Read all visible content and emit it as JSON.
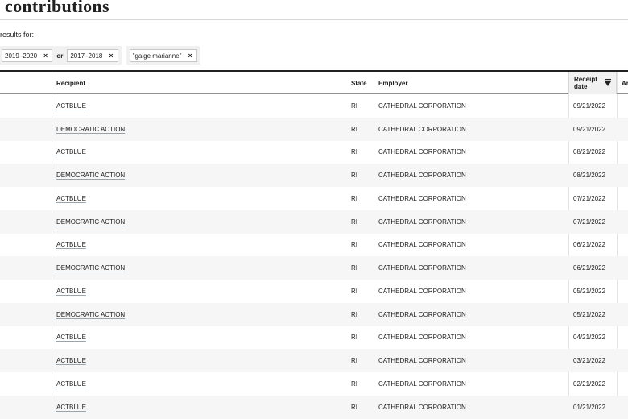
{
  "page": {
    "title": "contributions",
    "results_label": "results for:"
  },
  "filters": {
    "group1": {
      "tag1": "2019–2020",
      "or": "or",
      "tag2": "2017–2018"
    },
    "group2": {
      "tag1": "\"gaige marianne\""
    },
    "remove_glyph": "×"
  },
  "table": {
    "headers": {
      "recipient": "Recipient",
      "state": "State",
      "employer": "Employer",
      "receipt_date": "Receipt date",
      "amount": "Ar"
    },
    "rows": [
      {
        "recipient": "ACTBLUE",
        "state": "RI",
        "employer": "CATHEDRAL CORPORATION",
        "date": "09/21/2022"
      },
      {
        "recipient": "DEMOCRATIC ACTION",
        "state": "RI",
        "employer": "CATHEDRAL CORPORATION",
        "date": "09/21/2022"
      },
      {
        "recipient": "ACTBLUE",
        "state": "RI",
        "employer": "CATHEDRAL CORPORATION",
        "date": "08/21/2022"
      },
      {
        "recipient": "DEMOCRATIC ACTION",
        "state": "RI",
        "employer": "CATHEDRAL CORPORATION",
        "date": "08/21/2022"
      },
      {
        "recipient": "ACTBLUE",
        "state": "RI",
        "employer": "CATHEDRAL CORPORATION",
        "date": "07/21/2022"
      },
      {
        "recipient": "DEMOCRATIC ACTION",
        "state": "RI",
        "employer": "CATHEDRAL CORPORATION",
        "date": "07/21/2022"
      },
      {
        "recipient": "ACTBLUE",
        "state": "RI",
        "employer": "CATHEDRAL CORPORATION",
        "date": "06/21/2022"
      },
      {
        "recipient": "DEMOCRATIC ACTION",
        "state": "RI",
        "employer": "CATHEDRAL CORPORATION",
        "date": "06/21/2022"
      },
      {
        "recipient": "ACTBLUE",
        "state": "RI",
        "employer": "CATHEDRAL CORPORATION",
        "date": "05/21/2022"
      },
      {
        "recipient": "DEMOCRATIC ACTION",
        "state": "RI",
        "employer": "CATHEDRAL CORPORATION",
        "date": "05/21/2022"
      },
      {
        "recipient": "ACTBLUE",
        "state": "RI",
        "employer": "CATHEDRAL CORPORATION",
        "date": "04/21/2022"
      },
      {
        "recipient": "ACTBLUE",
        "state": "RI",
        "employer": "CATHEDRAL CORPORATION",
        "date": "03/21/2022"
      },
      {
        "recipient": "ACTBLUE",
        "state": "RI",
        "employer": "CATHEDRAL CORPORATION",
        "date": "02/21/2022"
      },
      {
        "recipient": "ACTBLUE",
        "state": "RI",
        "employer": "CATHEDRAL CORPORATION",
        "date": "01/21/2022"
      }
    ]
  }
}
